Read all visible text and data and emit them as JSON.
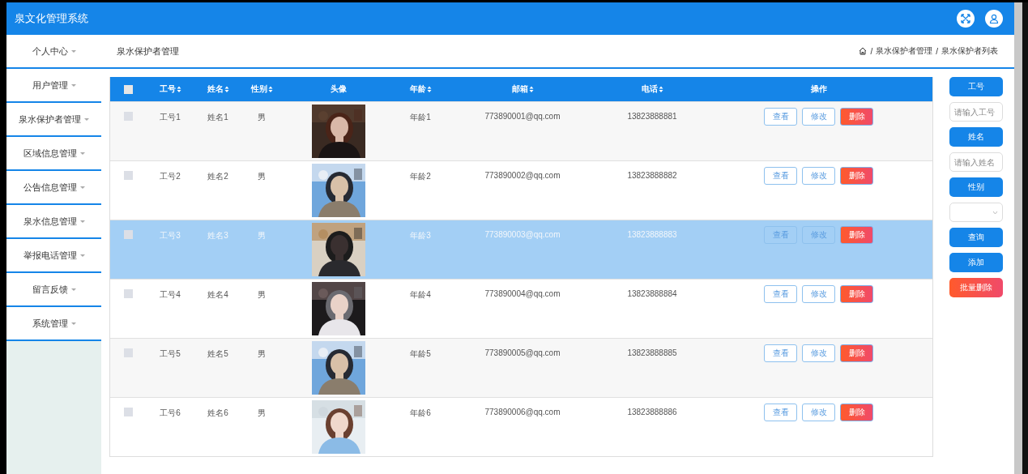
{
  "header": {
    "title": "泉文化管理系统"
  },
  "sidebar": {
    "items": [
      {
        "label": "个人中心"
      },
      {
        "label": "用户管理"
      },
      {
        "label": "泉水保护者管理"
      },
      {
        "label": "区域信息管理"
      },
      {
        "label": "公告信息管理"
      },
      {
        "label": "泉水信息管理"
      },
      {
        "label": "举报电话管理"
      },
      {
        "label": "留言反馈"
      },
      {
        "label": "系统管理"
      }
    ]
  },
  "page": {
    "title": "泉水保护者管理",
    "breadcrumb": [
      {
        "separator": "/",
        "label": "泉水保护者管理"
      },
      {
        "separator": "/",
        "label": "泉水保护者列表"
      }
    ]
  },
  "table": {
    "select_all": {
      "checked": false
    },
    "columns": [
      {
        "label": "工号",
        "sortable": true
      },
      {
        "label": "姓名",
        "sortable": true
      },
      {
        "label": "性别",
        "sortable": true
      },
      {
        "label": "头像",
        "sortable": false
      },
      {
        "label": "年龄",
        "sortable": true
      },
      {
        "label": "邮箱",
        "sortable": true
      },
      {
        "label": "电话",
        "sortable": true
      },
      {
        "label": "操作",
        "sortable": false
      }
    ],
    "rows": [
      {
        "checked": false,
        "selected": false,
        "id": "工号1",
        "name": "姓名1",
        "gender": "男",
        "age": "年龄1",
        "email": "773890001@qq.com",
        "phone": "13823888881",
        "actions": [
          {
            "label": "查看",
            "kind": "outline"
          },
          {
            "label": "修改",
            "kind": "outline"
          },
          {
            "label": "删除",
            "kind": "danger"
          }
        ]
      },
      {
        "checked": false,
        "selected": false,
        "id": "工号2",
        "name": "姓名2",
        "gender": "男",
        "age": "年龄2",
        "email": "773890002@qq.com",
        "phone": "13823888882",
        "actions": [
          {
            "label": "查看",
            "kind": "outline"
          },
          {
            "label": "修改",
            "kind": "outline"
          },
          {
            "label": "删除",
            "kind": "danger"
          }
        ]
      },
      {
        "checked": false,
        "selected": true,
        "id": "工号3",
        "name": "姓名3",
        "gender": "男",
        "age": "年龄3",
        "email": "773890003@qq.com",
        "phone": "13823888883",
        "actions": [
          {
            "label": "查看",
            "kind": "outline"
          },
          {
            "label": "修改",
            "kind": "outline"
          },
          {
            "label": "删除",
            "kind": "danger"
          }
        ]
      },
      {
        "checked": false,
        "selected": false,
        "id": "工号4",
        "name": "姓名4",
        "gender": "男",
        "age": "年龄4",
        "email": "773890004@qq.com",
        "phone": "13823888884",
        "actions": [
          {
            "label": "查看",
            "kind": "outline"
          },
          {
            "label": "修改",
            "kind": "outline"
          },
          {
            "label": "删除",
            "kind": "danger"
          }
        ]
      },
      {
        "checked": false,
        "selected": false,
        "id": "工号5",
        "name": "姓名5",
        "gender": "男",
        "age": "年龄5",
        "email": "773890005@qq.com",
        "phone": "13823888885",
        "actions": [
          {
            "label": "查看",
            "kind": "outline"
          },
          {
            "label": "修改",
            "kind": "outline"
          },
          {
            "label": "删除",
            "kind": "danger"
          }
        ]
      },
      {
        "checked": false,
        "selected": false,
        "id": "工号6",
        "name": "姓名6",
        "gender": "男",
        "age": "年龄6",
        "email": "773890006@qq.com",
        "phone": "13823888886",
        "actions": [
          {
            "label": "查看",
            "kind": "outline"
          },
          {
            "label": "修改",
            "kind": "outline"
          },
          {
            "label": "删除",
            "kind": "danger"
          }
        ]
      }
    ]
  },
  "search": [
    {
      "kind": "label",
      "text": "工号"
    },
    {
      "kind": "input",
      "placeholder": "请输入工号"
    },
    {
      "kind": "label",
      "text": "姓名"
    },
    {
      "kind": "input",
      "placeholder": "请输入姓名"
    },
    {
      "kind": "label",
      "text": "性别"
    },
    {
      "kind": "select"
    },
    {
      "kind": "button",
      "text": "查询"
    },
    {
      "kind": "button",
      "text": "添加"
    },
    {
      "kind": "danger",
      "text": "批量删除"
    }
  ]
}
